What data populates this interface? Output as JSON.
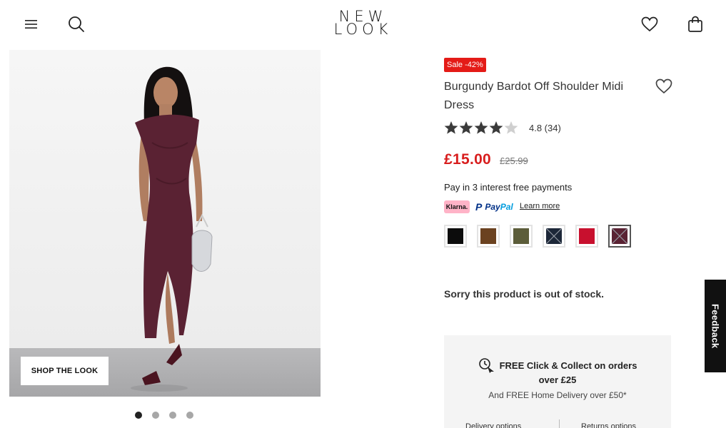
{
  "brand": {
    "logo_line1": "NEW",
    "logo_line2": "LOOK"
  },
  "header": {
    "menu_icon": "hamburger-menu-icon",
    "search_icon": "search-icon",
    "wishlist_icon": "heart-icon",
    "bag_icon": "shopping-bag-icon"
  },
  "gallery": {
    "shop_the_look_label": "SHOP THE LOOK",
    "image_count": 4,
    "active_index": 0
  },
  "product": {
    "sale_badge": "Sale -42%",
    "title": "Burgundy Bardot Off Shoulder Midi Dress",
    "rating_stars": 4.8,
    "rating_text": "4.8 (34)",
    "price": "£15.00",
    "was_price": "£25.99",
    "pay_in_text": "Pay in 3 interest free payments",
    "klarna_label": "Klarna.",
    "paypal_pay": "Pay",
    "paypal_pal": "Pal",
    "learn_more": "Learn more",
    "swatches": [
      {
        "name": "black",
        "color": "#0c0c0c",
        "available": true,
        "selected": false
      },
      {
        "name": "brown",
        "color": "#6b4220",
        "available": true,
        "selected": false
      },
      {
        "name": "khaki",
        "color": "#5c5d3a",
        "available": true,
        "selected": false
      },
      {
        "name": "navy",
        "color": "#1c2738",
        "available": false,
        "selected": false
      },
      {
        "name": "red",
        "color": "#c8102e",
        "available": true,
        "selected": false
      },
      {
        "name": "burgundy",
        "color": "#5a2233",
        "available": false,
        "selected": true
      }
    ],
    "out_of_stock": "Sorry this product is out of stock."
  },
  "delivery": {
    "line1": "FREE Click & Collect on orders",
    "line2": "over £25",
    "line3": "And FREE Home Delivery over £50*",
    "tab_delivery": "Delivery options",
    "tab_returns": "Returns options"
  },
  "feedback": {
    "label": "Feedback"
  },
  "colors": {
    "sale_red": "#d81e1e",
    "badge_red": "#e41b17",
    "dress": "#5a2233"
  }
}
